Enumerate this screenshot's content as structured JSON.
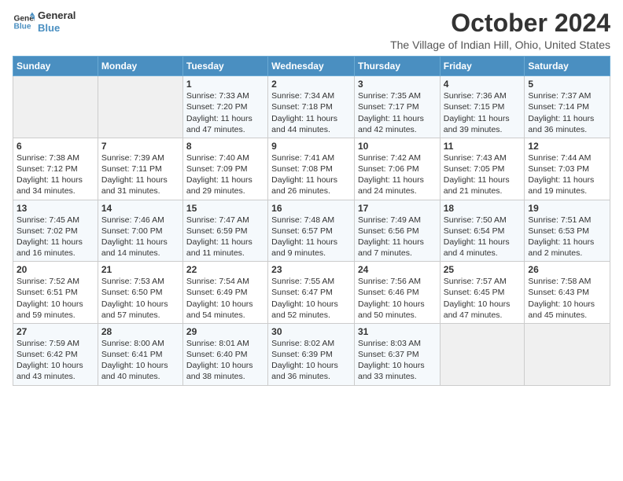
{
  "logo": {
    "line1": "General",
    "line2": "Blue"
  },
  "title": "October 2024",
  "subtitle": "The Village of Indian Hill, Ohio, United States",
  "days_of_week": [
    "Sunday",
    "Monday",
    "Tuesday",
    "Wednesday",
    "Thursday",
    "Friday",
    "Saturday"
  ],
  "weeks": [
    [
      {
        "day": "",
        "info": ""
      },
      {
        "day": "",
        "info": ""
      },
      {
        "day": "1",
        "info": "Sunrise: 7:33 AM\nSunset: 7:20 PM\nDaylight: 11 hours and 47 minutes."
      },
      {
        "day": "2",
        "info": "Sunrise: 7:34 AM\nSunset: 7:18 PM\nDaylight: 11 hours and 44 minutes."
      },
      {
        "day": "3",
        "info": "Sunrise: 7:35 AM\nSunset: 7:17 PM\nDaylight: 11 hours and 42 minutes."
      },
      {
        "day": "4",
        "info": "Sunrise: 7:36 AM\nSunset: 7:15 PM\nDaylight: 11 hours and 39 minutes."
      },
      {
        "day": "5",
        "info": "Sunrise: 7:37 AM\nSunset: 7:14 PM\nDaylight: 11 hours and 36 minutes."
      }
    ],
    [
      {
        "day": "6",
        "info": "Sunrise: 7:38 AM\nSunset: 7:12 PM\nDaylight: 11 hours and 34 minutes."
      },
      {
        "day": "7",
        "info": "Sunrise: 7:39 AM\nSunset: 7:11 PM\nDaylight: 11 hours and 31 minutes."
      },
      {
        "day": "8",
        "info": "Sunrise: 7:40 AM\nSunset: 7:09 PM\nDaylight: 11 hours and 29 minutes."
      },
      {
        "day": "9",
        "info": "Sunrise: 7:41 AM\nSunset: 7:08 PM\nDaylight: 11 hours and 26 minutes."
      },
      {
        "day": "10",
        "info": "Sunrise: 7:42 AM\nSunset: 7:06 PM\nDaylight: 11 hours and 24 minutes."
      },
      {
        "day": "11",
        "info": "Sunrise: 7:43 AM\nSunset: 7:05 PM\nDaylight: 11 hours and 21 minutes."
      },
      {
        "day": "12",
        "info": "Sunrise: 7:44 AM\nSunset: 7:03 PM\nDaylight: 11 hours and 19 minutes."
      }
    ],
    [
      {
        "day": "13",
        "info": "Sunrise: 7:45 AM\nSunset: 7:02 PM\nDaylight: 11 hours and 16 minutes."
      },
      {
        "day": "14",
        "info": "Sunrise: 7:46 AM\nSunset: 7:00 PM\nDaylight: 11 hours and 14 minutes."
      },
      {
        "day": "15",
        "info": "Sunrise: 7:47 AM\nSunset: 6:59 PM\nDaylight: 11 hours and 11 minutes."
      },
      {
        "day": "16",
        "info": "Sunrise: 7:48 AM\nSunset: 6:57 PM\nDaylight: 11 hours and 9 minutes."
      },
      {
        "day": "17",
        "info": "Sunrise: 7:49 AM\nSunset: 6:56 PM\nDaylight: 11 hours and 7 minutes."
      },
      {
        "day": "18",
        "info": "Sunrise: 7:50 AM\nSunset: 6:54 PM\nDaylight: 11 hours and 4 minutes."
      },
      {
        "day": "19",
        "info": "Sunrise: 7:51 AM\nSunset: 6:53 PM\nDaylight: 11 hours and 2 minutes."
      }
    ],
    [
      {
        "day": "20",
        "info": "Sunrise: 7:52 AM\nSunset: 6:51 PM\nDaylight: 10 hours and 59 minutes."
      },
      {
        "day": "21",
        "info": "Sunrise: 7:53 AM\nSunset: 6:50 PM\nDaylight: 10 hours and 57 minutes."
      },
      {
        "day": "22",
        "info": "Sunrise: 7:54 AM\nSunset: 6:49 PM\nDaylight: 10 hours and 54 minutes."
      },
      {
        "day": "23",
        "info": "Sunrise: 7:55 AM\nSunset: 6:47 PM\nDaylight: 10 hours and 52 minutes."
      },
      {
        "day": "24",
        "info": "Sunrise: 7:56 AM\nSunset: 6:46 PM\nDaylight: 10 hours and 50 minutes."
      },
      {
        "day": "25",
        "info": "Sunrise: 7:57 AM\nSunset: 6:45 PM\nDaylight: 10 hours and 47 minutes."
      },
      {
        "day": "26",
        "info": "Sunrise: 7:58 AM\nSunset: 6:43 PM\nDaylight: 10 hours and 45 minutes."
      }
    ],
    [
      {
        "day": "27",
        "info": "Sunrise: 7:59 AM\nSunset: 6:42 PM\nDaylight: 10 hours and 43 minutes."
      },
      {
        "day": "28",
        "info": "Sunrise: 8:00 AM\nSunset: 6:41 PM\nDaylight: 10 hours and 40 minutes."
      },
      {
        "day": "29",
        "info": "Sunrise: 8:01 AM\nSunset: 6:40 PM\nDaylight: 10 hours and 38 minutes."
      },
      {
        "day": "30",
        "info": "Sunrise: 8:02 AM\nSunset: 6:39 PM\nDaylight: 10 hours and 36 minutes."
      },
      {
        "day": "31",
        "info": "Sunrise: 8:03 AM\nSunset: 6:37 PM\nDaylight: 10 hours and 33 minutes."
      },
      {
        "day": "",
        "info": ""
      },
      {
        "day": "",
        "info": ""
      }
    ]
  ]
}
